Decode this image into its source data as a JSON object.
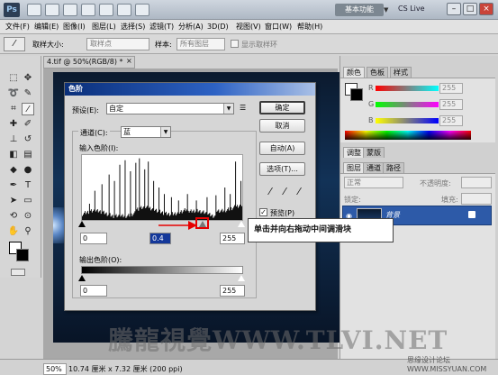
{
  "titlebar": {
    "logo": "Ps",
    "workspace": "基本功能",
    "cs_live": "CS Live",
    "workspace_arrow_icon": "chevron-down-icon"
  },
  "menus": [
    "文件(F)",
    "编辑(E)",
    "图像(I)",
    "图层(L)",
    "选择(S)",
    "滤镜(T)",
    "分析(A)",
    "3D(D)",
    "视图(V)",
    "窗口(W)",
    "帮助(H)"
  ],
  "options": {
    "sample_size_label": "取样大小:",
    "sample_size_value": "取样点",
    "sample_label": "样本:",
    "sample_value": "所有图层",
    "show_ring_label": "显示取样环"
  },
  "document": {
    "tab_title": "4.tif @ 50%(RGB/8) *",
    "zoom": "50%",
    "info": "10.74 厘米 x 7.32 厘米 (200 ppi)"
  },
  "panels": {
    "color_tabs": [
      "颜色",
      "色板",
      "样式"
    ],
    "sliders": [
      {
        "letter": "R",
        "value": "255",
        "from": "#ff0000",
        "to": "#00ffff"
      },
      {
        "letter": "G",
        "value": "255",
        "from": "#00ff00",
        "to": "#ff00ff"
      },
      {
        "letter": "B",
        "value": "255",
        "from": "#ffff00",
        "to": "#0000ff"
      }
    ],
    "adjust_tabs": [
      "调整",
      "蒙版"
    ],
    "layer_tabs": [
      "图层",
      "通道",
      "路径"
    ],
    "blend_mode": "正常",
    "opacity_label": "不透明度:",
    "lock_label": "锁定:",
    "fill_label": "填充:",
    "layer_name": "背景"
  },
  "dialog": {
    "title": "色阶",
    "preset_label": "预设(E):",
    "preset_value": "自定",
    "channel_label": "通道(C):",
    "channel_value": "蓝",
    "input_label": "输入色阶(I):",
    "input_black": "0",
    "input_gamma": "0.4",
    "input_white": "255",
    "output_label": "输出色阶(O):",
    "output_black": "0",
    "output_white": "255",
    "ok": "确定",
    "cancel": "取消",
    "auto": "自动(A)",
    "options": "选项(T)...",
    "preview": "预览(P)"
  },
  "callout": "单击并向右拖动中间调滑块",
  "watermark": "騰龍視覺WWW.TLVI.NET",
  "forum_watermark": "思缘设计论坛 WWW.MISSYUAN.COM"
}
